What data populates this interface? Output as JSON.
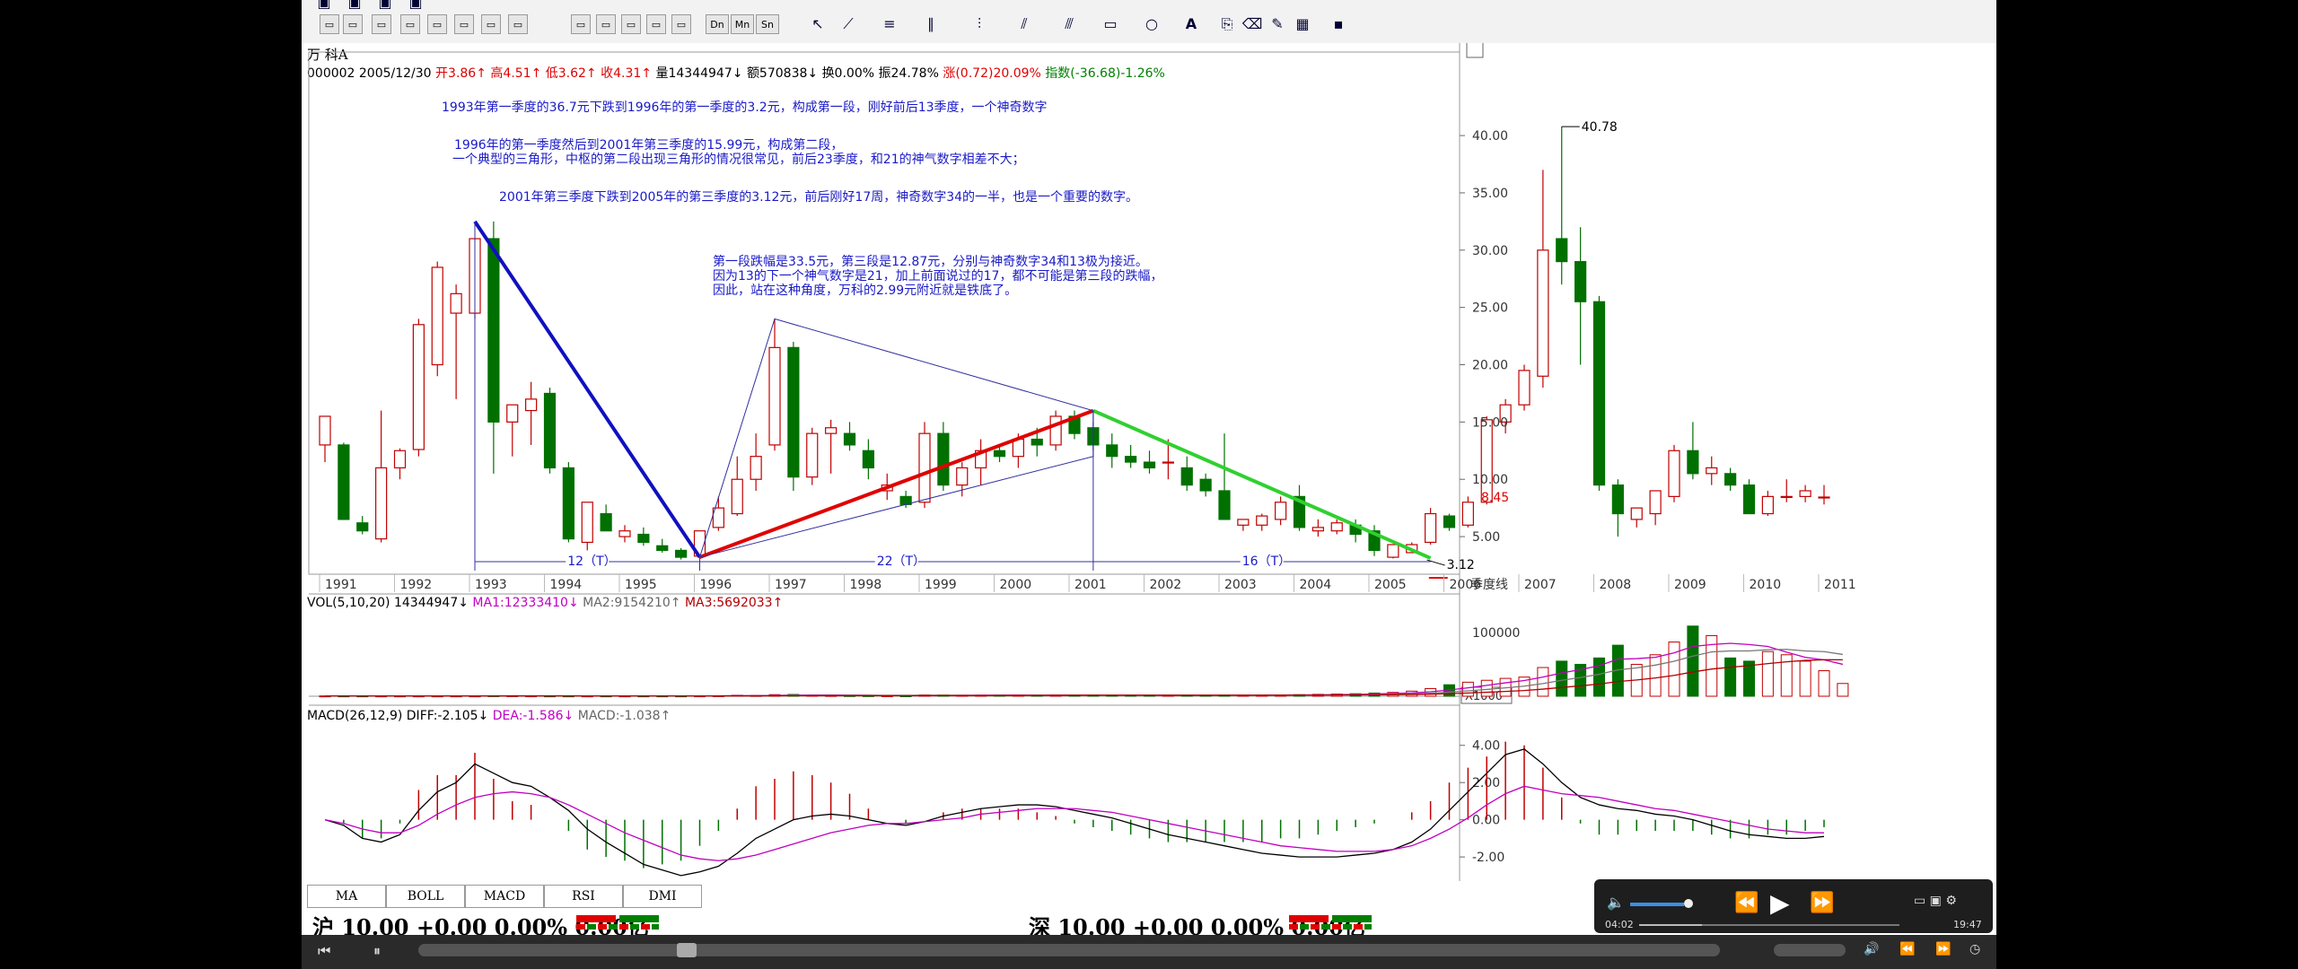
{
  "header": {
    "stock_name": "万 科A",
    "info_line": [
      {
        "text": "000002 2005/12/30",
        "color": "#000000"
      },
      {
        "text": "开3.86↑",
        "color": "#e00000"
      },
      {
        "text": "高4.51↑",
        "color": "#e00000"
      },
      {
        "text": "低3.62↑",
        "color": "#e00000"
      },
      {
        "text": "收4.31↑",
        "color": "#e00000"
      },
      {
        "text": "量14344947↓",
        "color": "#000000"
      },
      {
        "text": "额570838↓",
        "color": "#000000"
      },
      {
        "text": "换0.00%",
        "color": "#000000"
      },
      {
        "text": "振24.78%",
        "color": "#000000"
      },
      {
        "text": "涨(0.72)20.09%",
        "color": "#e00000"
      },
      {
        "text": "指数(-36.68)-1.26%",
        "color": "#008000"
      }
    ]
  },
  "annotations": [
    {
      "text": "1993年第一季度的36.7元下跌到1996年的第一季度的3.2元，构成第一段，刚好前后13季度，一个神奇数字"
    },
    {
      "text": "1996年的第一季度然后到2001年第三季度的15.99元，构成第二段，"
    },
    {
      "text": "一个典型的三角形，中枢的第二段出现三角形的情况很常见，前后23季度，和21的神气数字相差不大；"
    },
    {
      "text": "2001年第三季度下跌到2005年的第三季度的3.12元，前后刚好17周，神奇数字34的一半，也是一个重要的数字。"
    },
    {
      "text": "第一段跌幅是33.5元，第三段是12.87元，分别与神奇数字34和13极为接近。"
    },
    {
      "text": "因为13的下一个神气数字是21，加上前面说过的17，都不可能是第三段的跌幅，"
    },
    {
      "text": "因此，站在这种角度，万科的2.99元附近就是铁底了。"
    }
  ],
  "segments": {
    "s1": "12（T）",
    "s2": "22（T）",
    "s3": "16（T）"
  },
  "labels": {
    "high": "40.78",
    "low": "3.12",
    "price_tag": "8.45",
    "axis_mode": "季度线",
    "vol_unit": "X1000"
  },
  "vol_header": [
    {
      "text": "VOL(5,10,20)",
      "color": "#000000"
    },
    {
      "text": "14344947↓",
      "color": "#000000"
    },
    {
      "text": "MA1:12333410↓",
      "color": "#c000c0"
    },
    {
      "text": "MA2:9154210↑",
      "color": "#666666"
    },
    {
      "text": "MA3:5692033↑",
      "color": "#b00000"
    }
  ],
  "macd_header": [
    {
      "text": "MACD(26,12,9)",
      "color": "#000000"
    },
    {
      "text": "DIFF:-2.105↓",
      "color": "#000000"
    },
    {
      "text": "DEA:-1.586↓",
      "color": "#c000c0"
    },
    {
      "text": "MACD:-1.038↑",
      "color": "#666666"
    }
  ],
  "tabs": [
    "MA",
    "BOLL",
    "MACD",
    "RSI",
    "DMI"
  ],
  "markets": {
    "sh": "沪 10.00 +0.00 0.00% 0.00亿",
    "sz": "深 10.00 +0.00 0.00% 0.00亿"
  },
  "player": {
    "elapsed": "04:02",
    "total": "19:47"
  },
  "toolbar": {
    "row2_labels": [
      "Dn",
      "Mn",
      "Sn"
    ]
  },
  "colors": {
    "up": "#c00000",
    "down": "#007000",
    "seg1": "#1010c0",
    "seg2": "#e00000",
    "seg3": "#30d030",
    "triangle": "#3030a0"
  },
  "chart_data": [
    {
      "type": "candlestick",
      "title": "万 科A",
      "x_ticks": [
        "1991",
        "1992",
        "1993",
        "1994",
        "1995",
        "1996",
        "1997",
        "1998",
        "1999",
        "2000",
        "2001",
        "2002",
        "2003",
        "2004",
        "2005",
        "2006",
        "2007",
        "2008",
        "2009",
        "2010",
        "2011"
      ],
      "y_ticks": [
        5.0,
        10.0,
        15.0,
        20.0,
        25.0,
        30.0,
        35.0,
        40.0
      ],
      "ylim": [
        2.5,
        44
      ],
      "x_start": 1991.0,
      "quarter": 0.25,
      "candles": [
        [
          13.0,
          15.5,
          11.5,
          15.5
        ],
        [
          13.0,
          13.2,
          7.0,
          6.5
        ],
        [
          6.2,
          6.8,
          5.2,
          5.5
        ],
        [
          4.8,
          16.0,
          4.5,
          11.0
        ],
        [
          11.0,
          12.7,
          10.0,
          12.5
        ],
        [
          12.6,
          24.0,
          12.0,
          23.5
        ],
        [
          20.0,
          29.0,
          19.0,
          28.5
        ],
        [
          24.5,
          27.0,
          17.0,
          26.2
        ],
        [
          24.5,
          31.0,
          24.0,
          31.0
        ],
        [
          31.0,
          32.5,
          10.5,
          15.0
        ],
        [
          15.0,
          16.0,
          12.0,
          16.5
        ],
        [
          16.0,
          18.5,
          13.0,
          17.0
        ],
        [
          17.5,
          18.0,
          10.5,
          11.0
        ],
        [
          11.0,
          11.5,
          4.5,
          4.8
        ],
        [
          4.5,
          8.0,
          3.8,
          8.0
        ],
        [
          7.0,
          7.8,
          5.5,
          5.5
        ],
        [
          5.0,
          6.0,
          4.5,
          5.5
        ],
        [
          5.2,
          5.8,
          4.2,
          4.5
        ],
        [
          4.2,
          4.8,
          3.6,
          3.8
        ],
        [
          3.8,
          4.0,
          3.0,
          3.2
        ],
        [
          3.3,
          5.5,
          3.2,
          5.5
        ],
        [
          5.8,
          8.5,
          5.5,
          7.5
        ],
        [
          7.0,
          12.0,
          6.8,
          10.0
        ],
        [
          10.0,
          14.0,
          9.0,
          12.0
        ],
        [
          13.0,
          24.0,
          12.5,
          21.5
        ],
        [
          21.5,
          22.0,
          9.0,
          10.2
        ],
        [
          10.2,
          14.5,
          9.5,
          14.0
        ],
        [
          14.0,
          15.2,
          10.5,
          14.5
        ],
        [
          14.0,
          15.0,
          12.5,
          13.0
        ],
        [
          12.5,
          13.5,
          10.0,
          11.0
        ],
        [
          9.0,
          10.5,
          8.2,
          9.5
        ],
        [
          8.5,
          9.0,
          7.5,
          7.8
        ],
        [
          8.0,
          15.0,
          7.5,
          14.0
        ],
        [
          14.0,
          15.0,
          9.0,
          9.5
        ],
        [
          9.5,
          11.5,
          8.5,
          11.0
        ],
        [
          11.0,
          13.5,
          9.5,
          12.5
        ],
        [
          12.5,
          13.0,
          11.5,
          12.0
        ],
        [
          12.0,
          14.0,
          11.0,
          13.5
        ],
        [
          13.5,
          14.5,
          12.0,
          13.0
        ],
        [
          13.0,
          16.0,
          12.5,
          15.5
        ],
        [
          15.5,
          16.0,
          13.5,
          14.0
        ],
        [
          14.5,
          15.0,
          12.5,
          13.0
        ],
        [
          13.0,
          14.0,
          11.0,
          12.0
        ],
        [
          12.0,
          13.0,
          11.0,
          11.5
        ],
        [
          11.5,
          12.5,
          10.5,
          11.0
        ],
        [
          11.5,
          13.5,
          10.0,
          11.5
        ],
        [
          11.0,
          12.0,
          9.0,
          9.5
        ],
        [
          10.0,
          10.5,
          8.5,
          9.0
        ],
        [
          9.0,
          14.0,
          6.5,
          6.5
        ],
        [
          6.0,
          6.5,
          5.5,
          6.5
        ],
        [
          6.0,
          7.0,
          5.5,
          6.8
        ],
        [
          6.5,
          8.5,
          6.0,
          8.0
        ],
        [
          8.5,
          9.5,
          5.5,
          5.8
        ],
        [
          5.5,
          6.5,
          5.0,
          5.8
        ],
        [
          5.5,
          6.5,
          5.2,
          6.2
        ],
        [
          6.0,
          6.5,
          4.5,
          5.2
        ],
        [
          5.5,
          6.0,
          3.3,
          3.8
        ],
        [
          3.2,
          4.0,
          3.1,
          4.3
        ],
        [
          3.6,
          4.5,
          3.6,
          4.3
        ],
        [
          4.5,
          7.5,
          4.3,
          7.0
        ],
        [
          6.8,
          7.0,
          5.5,
          5.8
        ],
        [
          6.0,
          8.5,
          5.8,
          8.0
        ],
        [
          8.0,
          15.5,
          7.8,
          15.2
        ],
        [
          15.0,
          17.0,
          14.0,
          16.5
        ],
        [
          16.5,
          20.0,
          16.0,
          19.5
        ],
        [
          19.0,
          37.0,
          18.0,
          30.0
        ],
        [
          31.0,
          40.78,
          27.0,
          29.0
        ],
        [
          29.0,
          32.0,
          20.0,
          25.5
        ],
        [
          25.5,
          26.0,
          9.0,
          9.5
        ],
        [
          9.5,
          10.0,
          5.0,
          7.0
        ],
        [
          6.5,
          7.5,
          5.8,
          7.5
        ],
        [
          7.0,
          9.0,
          6.0,
          9.0
        ],
        [
          8.5,
          13.0,
          8.0,
          12.5
        ],
        [
          12.5,
          15.0,
          10.0,
          10.5
        ],
        [
          10.5,
          12.0,
          9.5,
          11.0
        ],
        [
          10.5,
          11.0,
          9.0,
          9.5
        ],
        [
          9.5,
          10.0,
          7.0,
          7.0
        ],
        [
          7.0,
          9.0,
          6.8,
          8.5
        ],
        [
          8.5,
          10.0,
          8.0,
          8.5
        ],
        [
          8.5,
          9.5,
          8.0,
          9.0
        ],
        [
          8.4,
          9.5,
          7.8,
          8.45
        ]
      ]
    },
    {
      "type": "bar",
      "title": "VOL(5,10,20)",
      "y_ticks": [
        100000
      ],
      "ylim": [
        0,
        135000
      ],
      "volumes": [
        500,
        500,
        500,
        500,
        500,
        500,
        500,
        500,
        500,
        800,
        800,
        600,
        500,
        500,
        500,
        500,
        500,
        500,
        500,
        500,
        600,
        800,
        1500,
        1200,
        2500,
        2800,
        1500,
        1200,
        1000,
        900,
        800,
        700,
        2000,
        1800,
        1500,
        1600,
        1600,
        1800,
        1600,
        1800,
        1500,
        1800,
        1700,
        1600,
        1500,
        1700,
        1600,
        1500,
        2000,
        1800,
        1800,
        2000,
        2500,
        3000,
        3500,
        4000,
        5000,
        6000,
        8000,
        12000,
        18000,
        22000,
        25000,
        28000,
        30000,
        45000,
        55000,
        50000,
        60000,
        80000,
        50000,
        65000,
        85000,
        110000,
        95000,
        60000,
        55000,
        70000,
        65000,
        55000,
        40000,
        20000
      ],
      "ma_lines": [
        "MA1",
        "MA2",
        "MA3"
      ]
    },
    {
      "type": "line",
      "title": "MACD(26,12,9)",
      "y_ticks": [
        -2.0,
        0.0,
        2.0,
        4.0
      ],
      "ylim": [
        -3.2,
        5.0
      ],
      "series": [
        {
          "name": "DIFF",
          "values": [
            0.0,
            -0.3,
            -1.0,
            -1.2,
            -0.8,
            0.5,
            1.5,
            2.0,
            3.0,
            2.5,
            2.0,
            1.8,
            1.2,
            0.5,
            -0.5,
            -1.2,
            -1.8,
            -2.4,
            -2.7,
            -3.0,
            -2.8,
            -2.5,
            -1.8,
            -1.0,
            -0.5,
            0.0,
            0.2,
            0.3,
            0.2,
            0.0,
            -0.2,
            -0.3,
            -0.1,
            0.2,
            0.4,
            0.6,
            0.7,
            0.8,
            0.8,
            0.7,
            0.5,
            0.3,
            0.1,
            -0.2,
            -0.5,
            -0.8,
            -1.0,
            -1.2,
            -1.4,
            -1.6,
            -1.8,
            -1.9,
            -2.0,
            -2.0,
            -2.0,
            -1.9,
            -1.8,
            -1.6,
            -1.2,
            -0.5,
            0.5,
            1.5,
            2.5,
            3.5,
            3.8,
            3.0,
            2.0,
            1.2,
            0.8,
            0.6,
            0.5,
            0.3,
            0.2,
            0.0,
            -0.3,
            -0.6,
            -0.8,
            -0.9,
            -1.0,
            -1.0,
            -0.9
          ]
        },
        {
          "name": "DEA",
          "values": [
            0.0,
            -0.2,
            -0.5,
            -0.7,
            -0.7,
            -0.3,
            0.3,
            0.8,
            1.2,
            1.4,
            1.5,
            1.4,
            1.2,
            0.8,
            0.3,
            -0.2,
            -0.7,
            -1.1,
            -1.5,
            -1.9,
            -2.1,
            -2.2,
            -2.1,
            -1.9,
            -1.6,
            -1.3,
            -1.0,
            -0.7,
            -0.5,
            -0.3,
            -0.2,
            -0.2,
            -0.1,
            0.0,
            0.1,
            0.3,
            0.4,
            0.5,
            0.6,
            0.6,
            0.6,
            0.5,
            0.4,
            0.2,
            0.0,
            -0.2,
            -0.4,
            -0.6,
            -0.8,
            -1.0,
            -1.2,
            -1.4,
            -1.5,
            -1.6,
            -1.7,
            -1.7,
            -1.7,
            -1.6,
            -1.4,
            -1.0,
            -0.5,
            0.1,
            0.8,
            1.4,
            1.8,
            1.6,
            1.4,
            1.3,
            1.2,
            1.0,
            0.8,
            0.6,
            0.5,
            0.3,
            0.1,
            -0.1,
            -0.3,
            -0.5,
            -0.6,
            -0.7,
            -0.7
          ]
        }
      ]
    }
  ]
}
